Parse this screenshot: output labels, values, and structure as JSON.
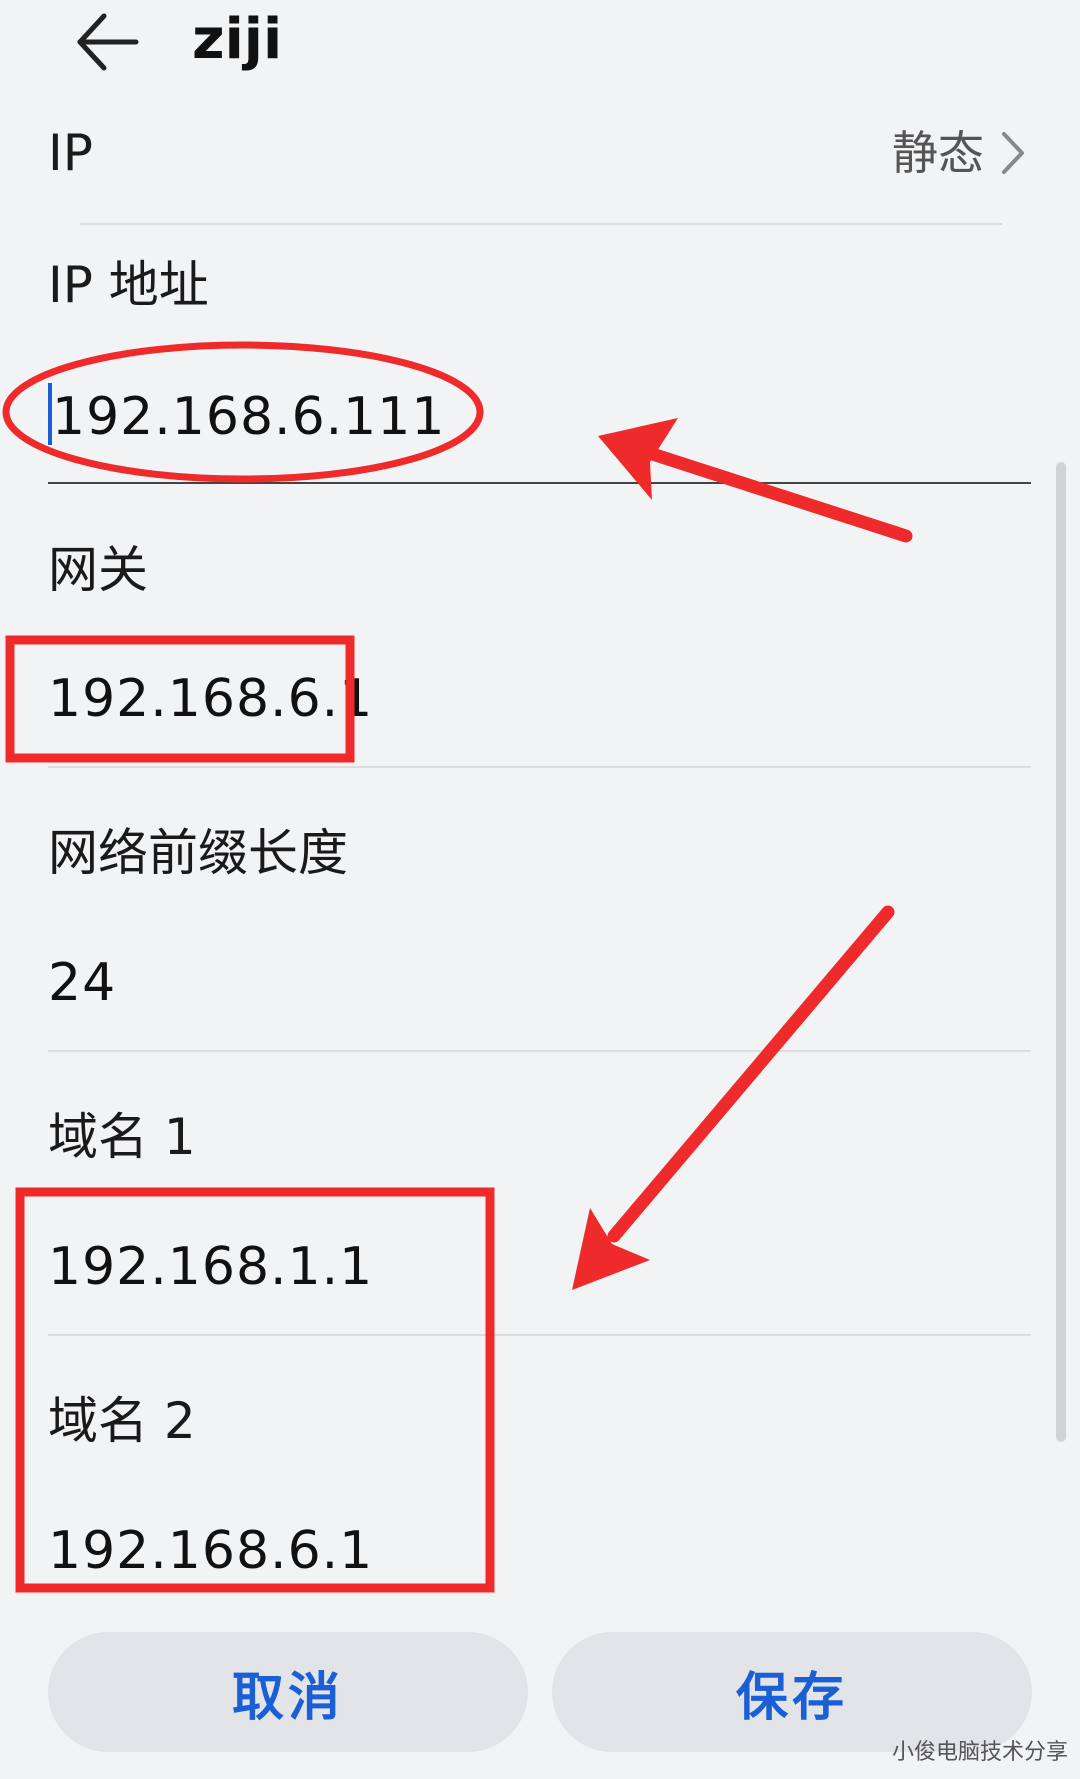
{
  "header": {
    "title": "ziji",
    "back_icon": "arrow-left-icon"
  },
  "ip_mode": {
    "label": "IP",
    "value": "静态",
    "chevron_icon": "chevron-right-icon"
  },
  "ip_address": {
    "label": "IP 地址",
    "value": "192.168.6.111"
  },
  "gateway": {
    "label": "网关",
    "value": "192.168.6.1"
  },
  "prefix_length": {
    "label": "网络前缀长度",
    "value": "24"
  },
  "dns1": {
    "label": "域名 1",
    "value": "192.168.1.1"
  },
  "dns2": {
    "label": "域名 2",
    "value": "192.168.6.1"
  },
  "actions": {
    "cancel_label": "取消",
    "save_label": "保存"
  },
  "watermark": "小俊电脑技术分享",
  "colors": {
    "accent": "#1b5fd6",
    "annotation": "#ee2a2a",
    "background": "#f2f3f5"
  }
}
